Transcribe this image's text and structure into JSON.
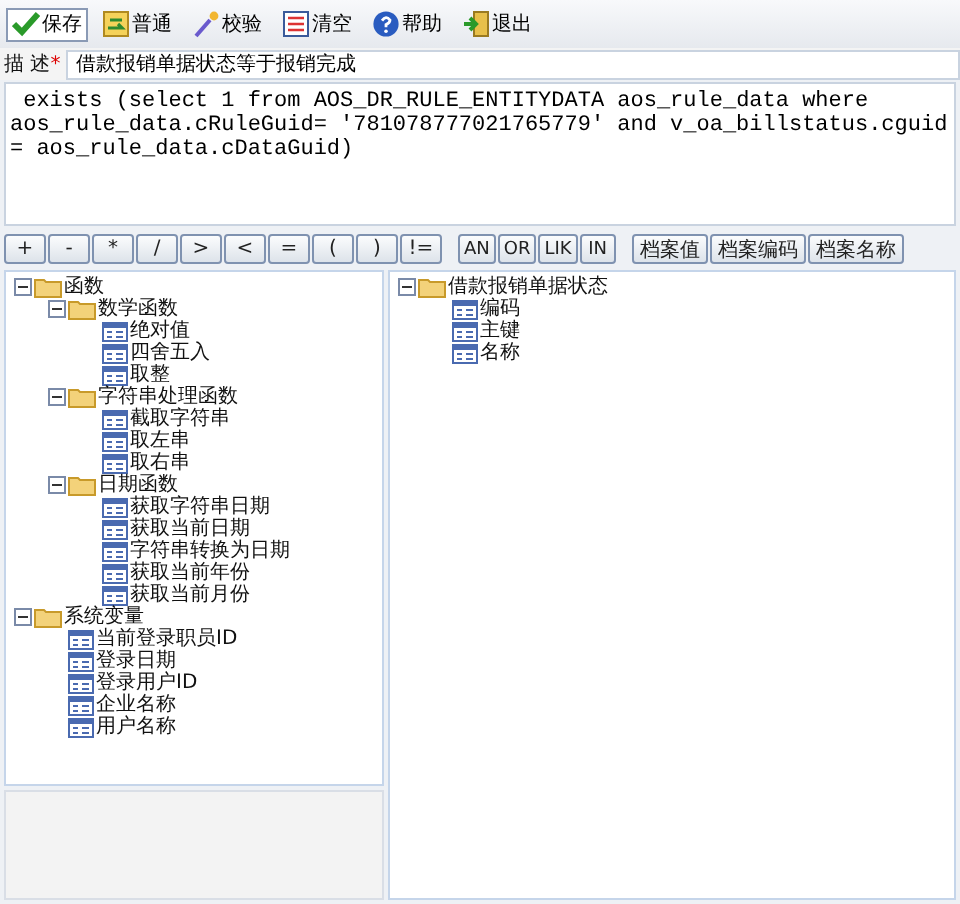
{
  "toolbar": [
    "保存",
    "普通",
    "校验",
    "清空",
    "帮助",
    "退出"
  ],
  "description": {
    "label": "描 述",
    "required_mark": "*",
    "value": "借款报销单据状态等于报销完成"
  },
  "expression": " exists (select 1 from AOS_DR_RULE_ENTITYDATA aos_rule_data where aos_rule_data.cRuleGuid= '781078777021765779' and v_oa_billstatus.cguid = aos_rule_data.cDataGuid)",
  "operators": [
    "+",
    "-",
    "*",
    "/",
    ">",
    "<",
    "=",
    "(",
    ")",
    "!="
  ],
  "logic_buttons": [
    "AN",
    "OR",
    "LIK",
    "IN"
  ],
  "field_buttons": [
    "档案值",
    "档案编码",
    "档案名称"
  ],
  "function_tree": [
    {
      "kind": "folder",
      "label": "函数",
      "expanded": true,
      "children": [
        {
          "kind": "folder",
          "label": "数学函数",
          "expanded": true,
          "children": [
            {
              "kind": "leaf",
              "label": "绝对值"
            },
            {
              "kind": "leaf",
              "label": "四舍五入"
            },
            {
              "kind": "leaf",
              "label": "取整"
            }
          ]
        },
        {
          "kind": "folder",
          "label": "字符串处理函数",
          "expanded": true,
          "children": [
            {
              "kind": "leaf",
              "label": "截取字符串"
            },
            {
              "kind": "leaf",
              "label": "取左串"
            },
            {
              "kind": "leaf",
              "label": "取右串"
            }
          ]
        },
        {
          "kind": "folder",
          "label": "日期函数",
          "expanded": true,
          "children": [
            {
              "kind": "leaf",
              "label": "获取字符串日期"
            },
            {
              "kind": "leaf",
              "label": "获取当前日期"
            },
            {
              "kind": "leaf",
              "label": "字符串转换为日期"
            },
            {
              "kind": "leaf",
              "label": "获取当前年份"
            },
            {
              "kind": "leaf",
              "label": "获取当前月份"
            }
          ]
        }
      ]
    },
    {
      "kind": "folder",
      "label": "系统变量",
      "expanded": true,
      "children": [
        {
          "kind": "leaf",
          "label": "当前登录职员ID"
        },
        {
          "kind": "leaf",
          "label": "登录日期"
        },
        {
          "kind": "leaf",
          "label": "登录用户ID"
        },
        {
          "kind": "leaf",
          "label": "企业名称"
        },
        {
          "kind": "leaf",
          "label": "用户名称"
        }
      ]
    }
  ],
  "field_tree": [
    {
      "kind": "folder",
      "label": "借款报销单据状态",
      "expanded": true,
      "children": [
        {
          "kind": "leaf",
          "label": "编码"
        },
        {
          "kind": "leaf",
          "label": "主键"
        },
        {
          "kind": "leaf",
          "label": "名称"
        }
      ]
    }
  ]
}
